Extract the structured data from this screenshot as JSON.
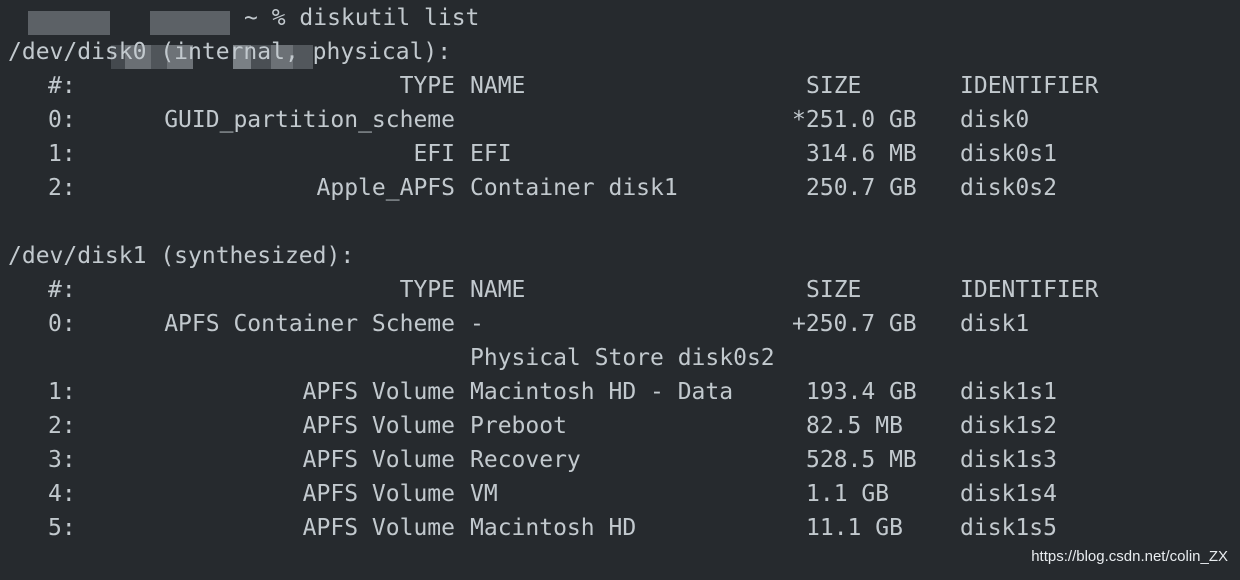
{
  "prompt": {
    "command": "~ % diskutil list"
  },
  "sections": [
    {
      "header": "/dev/disk0 (internal, physical):",
      "columns": {
        "idx": "#:",
        "type": "TYPE",
        "name": "NAME",
        "size": "SIZE",
        "id": "IDENTIFIER"
      },
      "rows": [
        {
          "idx": "0:",
          "type": "GUID_partition_scheme",
          "name": "",
          "size": "*251.0 GB",
          "id": "disk0"
        },
        {
          "idx": "1:",
          "type": "EFI",
          "name": "EFI",
          "size": "314.6 MB",
          "id": "disk0s1"
        },
        {
          "idx": "2:",
          "type": "Apple_APFS",
          "name": "Container disk1",
          "size": "250.7 GB",
          "id": "disk0s2"
        }
      ]
    },
    {
      "header": "/dev/disk1 (synthesized):",
      "columns": {
        "idx": "#:",
        "type": "TYPE",
        "name": "NAME",
        "size": "SIZE",
        "id": "IDENTIFIER"
      },
      "rows": [
        {
          "idx": "0:",
          "type": "APFS Container Scheme",
          "name": "-",
          "size": "+250.7 GB",
          "id": "disk1"
        },
        {
          "idx": "",
          "type": "",
          "name": "Physical Store disk0s2",
          "size": "",
          "id": ""
        },
        {
          "idx": "1:",
          "type": "APFS Volume",
          "name": "Macintosh HD - Data",
          "size": "193.4 GB",
          "id": "disk1s1"
        },
        {
          "idx": "2:",
          "type": "APFS Volume",
          "name": "Preboot",
          "size": "82.5 MB",
          "id": "disk1s2"
        },
        {
          "idx": "3:",
          "type": "APFS Volume",
          "name": "Recovery",
          "size": "528.5 MB",
          "id": "disk1s3"
        },
        {
          "idx": "4:",
          "type": "APFS Volume",
          "name": "VM",
          "size": "1.1 GB",
          "id": "disk1s4"
        },
        {
          "idx": "5:",
          "type": "APFS Volume",
          "name": "Macintosh HD",
          "size": "11.1 GB",
          "id": "disk1s5"
        }
      ]
    }
  ],
  "watermark": "https://blog.csdn.net/colin_ZX",
  "colors": {
    "background": "#262a2e",
    "text": "#c2c9ce",
    "redaction": "#5c6166"
  }
}
